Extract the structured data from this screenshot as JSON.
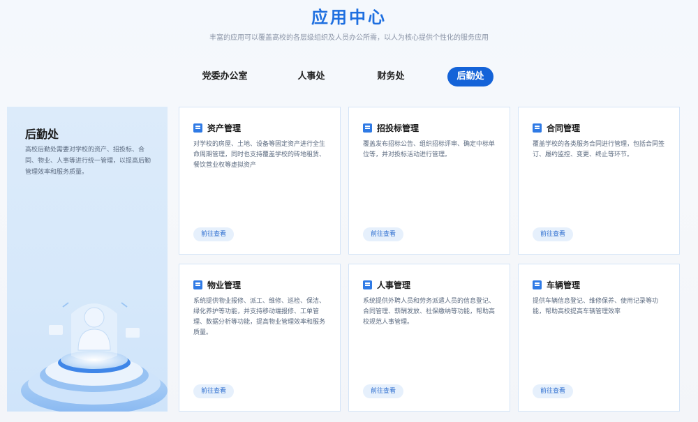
{
  "header": {
    "title": "应用中心",
    "subtitle": "丰富的应用可以覆盖高校的各层级组织及人员办公所需，以人为核心提供个性化的服务应用"
  },
  "tabs": [
    {
      "label": "党委办公室",
      "active": false
    },
    {
      "label": "人事处",
      "active": false
    },
    {
      "label": "财务处",
      "active": false
    },
    {
      "label": "后勤处",
      "active": true
    }
  ],
  "side_panel": {
    "title": "后勤处",
    "description": "高校后勤处需要对学校的资产、招投标、合同、物业、人事等进行统一管理，以提高后勤管理效率和服务质量。"
  },
  "cards": [
    {
      "title": "资产管理",
      "description": "对学校的房屋、土地、设备等固定资产进行全生命周期管理，同时也支持覆盖学校的砖地租赁、餐饮营业权等虚拟资产",
      "button": "前往查看",
      "icon": "document-icon"
    },
    {
      "title": "招投标管理",
      "description": "覆盖发布招标公告、组织招标评审、确定中标单位等，并对投标活动进行管理。",
      "button": "前往查看",
      "icon": "document-icon"
    },
    {
      "title": "合同管理",
      "description": "覆盖学校的各类服务合同进行管理，包括合同签订、履约监控、变更、终止等环节。",
      "button": "前往查看",
      "icon": "document-icon"
    },
    {
      "title": "物业管理",
      "description": "系统提供物业报修、派工、维修、巡检、保洁、绿化养护等功能，并支持移动端报修、工单管理、数据分析等功能，提高物业管理效率和服务质量。",
      "button": "前往查看",
      "icon": "document-icon"
    },
    {
      "title": "人事管理",
      "description": "系统提供外聘人员和劳务派遣人员的信息登记、合同管理、薪酬发放、社保缴纳等功能，帮助高校规范人事管理。",
      "button": "前往查看",
      "icon": "document-icon"
    },
    {
      "title": "车辆管理",
      "description": "提供车辆信息登记、维修保养、使用记录等功能，帮助高校提高车辆管理效率",
      "button": "前往查看",
      "icon": "document-icon"
    }
  ],
  "colors": {
    "accent": "#1463d8",
    "title": "#1e6fe0",
    "panel": "#dcebfa"
  }
}
